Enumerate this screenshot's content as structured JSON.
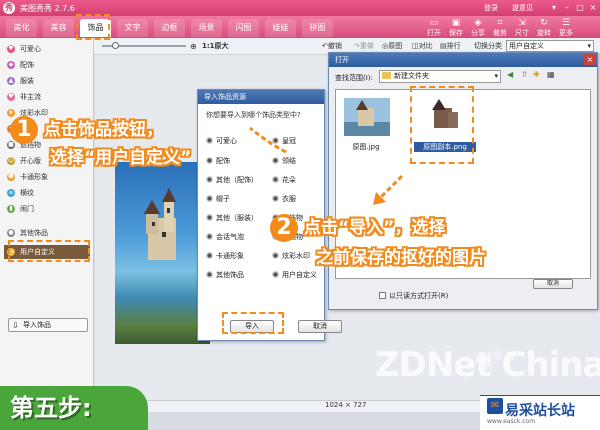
{
  "app": {
    "title": "美图秀秀 2.7.6",
    "login": "登录",
    "feedback": "提意见"
  },
  "tabs": [
    "美化",
    "美容",
    "饰品",
    "文字",
    "边框",
    "场景",
    "闪图",
    "娃娃",
    "拼图"
  ],
  "active_tab": "饰品",
  "tools": [
    {
      "label": "打开",
      "icon": "folder-icon"
    },
    {
      "label": "保存",
      "icon": "save-icon"
    },
    {
      "label": "分享",
      "icon": "share-icon"
    },
    {
      "label": "裁剪",
      "icon": "crop-icon"
    },
    {
      "label": "尺寸",
      "icon": "resize-icon"
    },
    {
      "label": "旋转",
      "icon": "rotate-icon"
    },
    {
      "label": "更多",
      "icon": "more-icon"
    }
  ],
  "left_panel": {
    "categories": [
      "可爱心",
      "配饰",
      "服装",
      "非主流",
      "炫彩水印",
      "烟花",
      "遮挡物",
      "开心版",
      "卡通形象",
      "横纹",
      "闹门",
      "其他饰品",
      "用户自定义"
    ],
    "selected": "用户自定义",
    "import_button": "导入饰品"
  },
  "subbar": {
    "zoom": "1:1原大",
    "undo": "撤销",
    "redo": "重做",
    "original": "原图",
    "compare": "对比",
    "sort": "排行",
    "category_label": "切换分类",
    "category_value": "用户自定义"
  },
  "canvas_size": "1024 × 727",
  "import_dialog": {
    "title": "导入饰品资源",
    "question": "你想要导入到哪个饰品类型中?",
    "options_left": [
      "可爱心",
      "配饰",
      "其他（配饰）",
      "帽子",
      "其他（服装）",
      "会话气泡",
      "卡通形象",
      "其他饰品"
    ],
    "options_right": [
      "皇冠",
      "领结",
      "花朵",
      "衣服",
      "遮挡物",
      "遮挡物",
      "炫彩水印",
      "用户自定义"
    ],
    "import_button": "导入",
    "cancel_button": "取消"
  },
  "open_dialog": {
    "title": "打开",
    "look_in_label": "查找范围(I):",
    "folder": "新建文件夹",
    "files": [
      "原图.jpg",
      "原图副本.png"
    ],
    "selected_file": "原图副本.png",
    "readonly_label": "以只读方式打开(R)",
    "cancel_button": "取消"
  },
  "annotations": [
    {
      "number": "1",
      "line1": "点击饰品按钮，",
      "line2": "选择“用户自定义”"
    },
    {
      "number": "2",
      "line1": "点击“导入”，选择",
      "line2": "之前保存的抠好的图片"
    }
  ],
  "step_label": "第五步:",
  "watermark": {
    "zd": "ZDNet China",
    "zd_cn": "中国 商界"
  },
  "brand": {
    "name": "易采站长站",
    "url": "www.easck.com"
  },
  "colors": {
    "accent": "#f28a1c",
    "titlebar": "#d43e72",
    "step_green": "#4aa63a",
    "brand_blue": "#1d4fa0"
  }
}
